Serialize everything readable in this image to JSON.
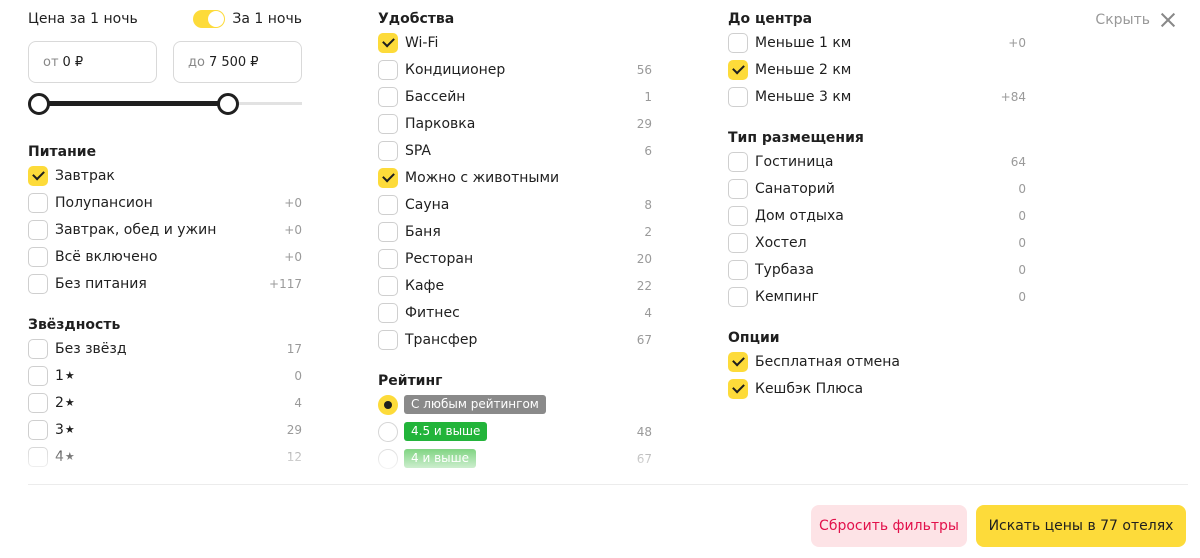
{
  "header": {
    "hide_label": "Скрыть"
  },
  "price": {
    "title": "Цена за 1 ночь",
    "toggle_label": "За 1 ночь",
    "from_prefix": "от",
    "from_value": "0 ₽",
    "to_prefix": "до",
    "to_value": "7 500 ₽"
  },
  "food": {
    "title": "Питание",
    "items": [
      {
        "label": "Завтрак",
        "count": "",
        "checked": true
      },
      {
        "label": "Полупансион",
        "count": "+0",
        "checked": false
      },
      {
        "label": "Завтрак, обед и ужин",
        "count": "+0",
        "checked": false
      },
      {
        "label": "Всё включено",
        "count": "+0",
        "checked": false
      },
      {
        "label": "Без питания",
        "count": "+117",
        "checked": false
      }
    ]
  },
  "stars": {
    "title": "Звёздность",
    "items": [
      {
        "label": "Без звёзд",
        "count": "17",
        "checked": false
      },
      {
        "label": "1",
        "count": "0",
        "checked": false
      },
      {
        "label": "2",
        "count": "4",
        "checked": false
      },
      {
        "label": "3",
        "count": "29",
        "checked": false
      },
      {
        "label": "4",
        "count": "12",
        "checked": false
      }
    ]
  },
  "amenities": {
    "title": "Удобства",
    "items": [
      {
        "label": "Wi-Fi",
        "count": "",
        "checked": true
      },
      {
        "label": "Кондиционер",
        "count": "56",
        "checked": false
      },
      {
        "label": "Бассейн",
        "count": "1",
        "checked": false
      },
      {
        "label": "Парковка",
        "count": "29",
        "checked": false
      },
      {
        "label": "SPA",
        "count": "6",
        "checked": false
      },
      {
        "label": "Можно с животными",
        "count": "",
        "checked": true
      },
      {
        "label": "Сауна",
        "count": "8",
        "checked": false
      },
      {
        "label": "Баня",
        "count": "2",
        "checked": false
      },
      {
        "label": "Ресторан",
        "count": "20",
        "checked": false
      },
      {
        "label": "Кафе",
        "count": "22",
        "checked": false
      },
      {
        "label": "Фитнес",
        "count": "4",
        "checked": false
      },
      {
        "label": "Трансфер",
        "count": "67",
        "checked": false
      }
    ]
  },
  "rating": {
    "title": "Рейтинг",
    "items": [
      {
        "label": "С любым рейтингом",
        "count": "",
        "selected": true,
        "color": "#8a8a8a"
      },
      {
        "label": "4.5 и выше",
        "count": "48",
        "selected": false,
        "color": "#22b43a"
      },
      {
        "label": "4 и выше",
        "count": "67",
        "selected": false,
        "color": "#5cc85f"
      }
    ]
  },
  "distance": {
    "title": "До центра",
    "items": [
      {
        "label": "Меньше 1 км",
        "count": "+0",
        "checked": false
      },
      {
        "label": "Меньше 2 км",
        "count": "",
        "checked": true
      },
      {
        "label": "Меньше 3 км",
        "count": "+84",
        "checked": false
      }
    ]
  },
  "accommodation": {
    "title": "Тип размещения",
    "items": [
      {
        "label": "Гостиница",
        "count": "64",
        "checked": false
      },
      {
        "label": "Санаторий",
        "count": "0",
        "checked": false
      },
      {
        "label": "Дом отдыха",
        "count": "0",
        "checked": false
      },
      {
        "label": "Хостел",
        "count": "0",
        "checked": false
      },
      {
        "label": "Турбаза",
        "count": "0",
        "checked": false
      },
      {
        "label": "Кемпинг",
        "count": "0",
        "checked": false
      }
    ]
  },
  "options": {
    "title": "Опции",
    "items": [
      {
        "label": "Бесплатная отмена",
        "count": "",
        "checked": true
      },
      {
        "label": "Кешбэк Плюса",
        "count": "",
        "checked": true
      }
    ]
  },
  "footer": {
    "reset_label": "Сбросить фильтры",
    "search_label": "Искать цены в 77 отелях"
  },
  "colors": {
    "accent": "#fddb3a",
    "reset_bg": "#fde3e6",
    "reset_text": "#e2114b"
  },
  "icons": {
    "star": "★"
  }
}
